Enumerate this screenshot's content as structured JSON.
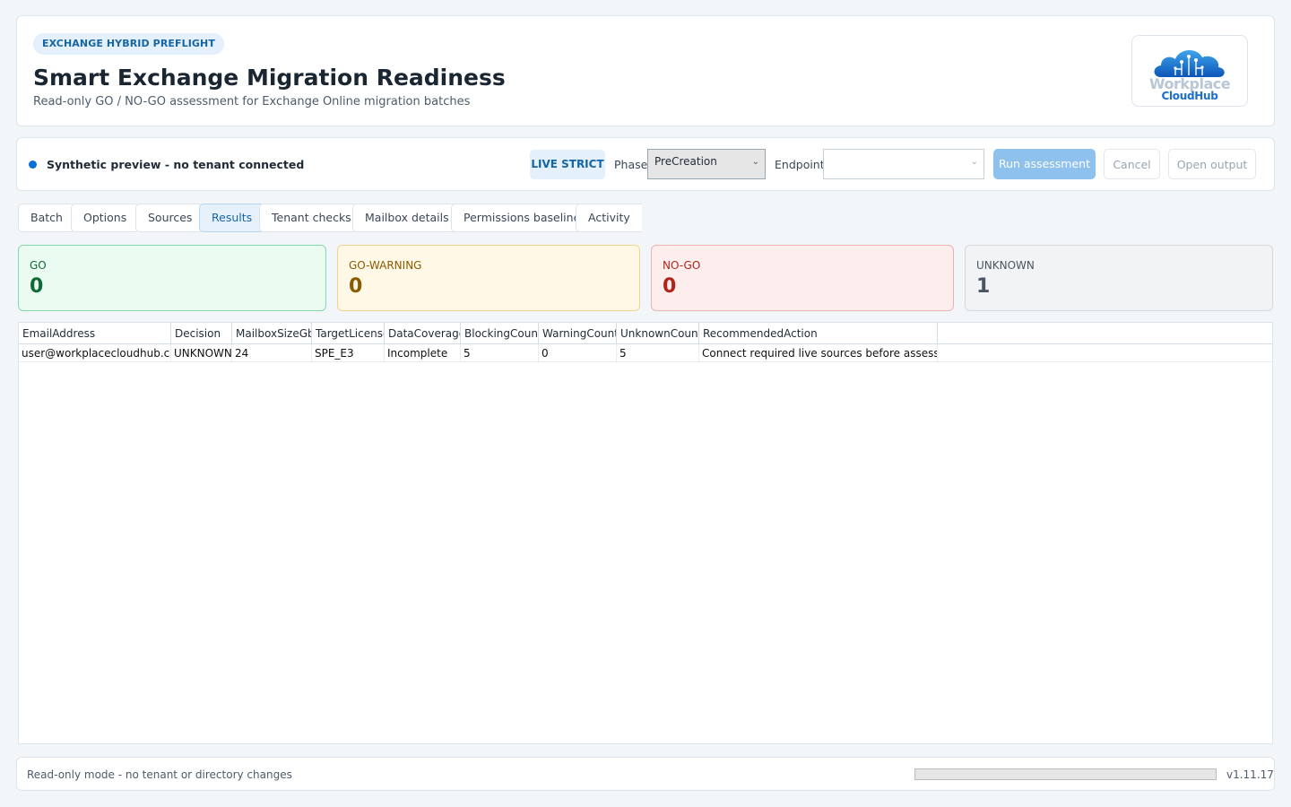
{
  "header": {
    "badge": "EXCHANGE HYBRID PREFLIGHT",
    "title": "Smart Exchange Migration Readiness",
    "subtitle": "Read-only GO / NO-GO assessment for Exchange Online migration batches",
    "logo": {
      "word1": "Workplace",
      "word2": "CloudHub"
    }
  },
  "toolbar": {
    "status_text": "Synthetic preview - no tenant connected",
    "mode_badge": "LIVE STRICT",
    "phase_label": "Phase",
    "phase_value": "PreCreation",
    "endpoint_label": "Endpoint",
    "endpoint_value": "",
    "run_label": "Run assessment",
    "cancel_label": "Cancel",
    "open_label": "Open output"
  },
  "tabs": [
    {
      "label": "Batch",
      "active": false
    },
    {
      "label": "Options",
      "active": false
    },
    {
      "label": "Sources",
      "active": false
    },
    {
      "label": "Results",
      "active": true
    },
    {
      "label": "Tenant checks",
      "active": false
    },
    {
      "label": "Mailbox details",
      "active": false
    },
    {
      "label": "Permissions baseline",
      "active": false
    },
    {
      "label": "Activity",
      "active": false
    }
  ],
  "summary": [
    {
      "label": "GO",
      "count": "0",
      "text_color": "#0f6b35",
      "bg": "#eafbf1",
      "border": "#86d9a8"
    },
    {
      "label": "GO-WARNING",
      "count": "0",
      "text_color": "#8a5a00",
      "bg": "#fff8e6",
      "border": "#f1d48c"
    },
    {
      "label": "NO-GO",
      "count": "0",
      "text_color": "#b42318",
      "bg": "#fdeeee",
      "border": "#efb2b2"
    },
    {
      "label": "UNKNOWN",
      "count": "1",
      "text_color": "#4a5563",
      "bg": "#f1f3f5",
      "border": "#d3d8de"
    }
  ],
  "table": {
    "columns": [
      "EmailAddress",
      "Decision",
      "MailboxSizeGb",
      "TargetLicense",
      "DataCoverage",
      "BlockingCount",
      "WarningCount",
      "UnknownCount",
      "RecommendedAction"
    ],
    "rows": [
      [
        "user@workplacecloudhub.com",
        "UNKNOWN",
        "24",
        "SPE_E3",
        "Incomplete",
        "5",
        "0",
        "5",
        "Connect required live sources before assessment."
      ]
    ]
  },
  "footer": {
    "status": "Read-only mode - no tenant or directory changes",
    "progress": 0,
    "version": "v1.11.17"
  },
  "colors": {
    "accent": "#0a6fd6",
    "run_button_bg": "#8ec1ee",
    "badge_bg": "#e4f0fb",
    "badge_text": "#1565a6"
  }
}
